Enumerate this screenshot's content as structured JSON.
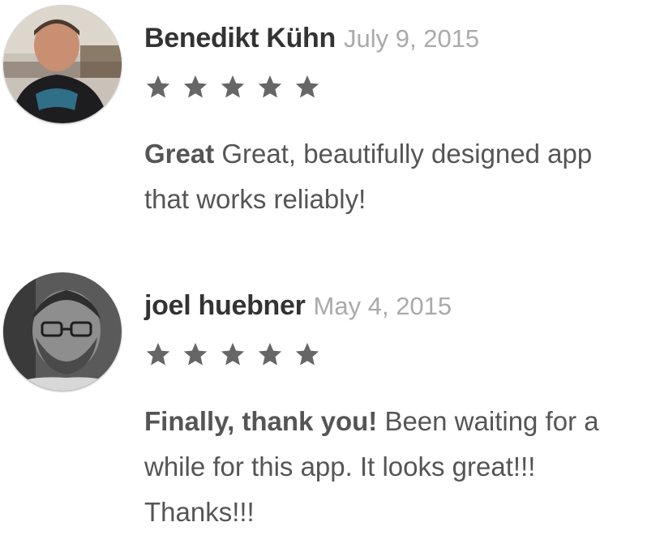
{
  "reviews": [
    {
      "author": "Benedikt Kühn",
      "date": "July 9, 2015",
      "rating": 5,
      "headline": "Great",
      "text": "Great, beautifully designed app that works reliably!",
      "avatar_icon": "person-photo-avatar"
    },
    {
      "author": "joel huebner",
      "date": "May 4, 2015",
      "rating": 5,
      "headline": "Finally, thank you!",
      "text": "Been waiting for a while for this app. It looks great!!! Thanks!!!",
      "avatar_icon": "person-photo-avatar"
    }
  ],
  "colors": {
    "author": "#333333",
    "date": "#aaaaaa",
    "text": "#555555",
    "star": "#666666"
  }
}
